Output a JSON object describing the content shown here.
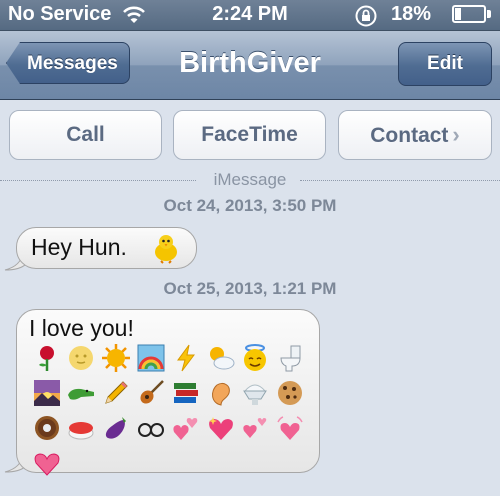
{
  "status_bar": {
    "carrier": "No Service",
    "time": "2:24 PM",
    "battery": "18%",
    "icons": [
      "wifi-icon",
      "rotation-lock-icon",
      "battery-icon"
    ]
  },
  "nav": {
    "back_label": "Messages",
    "title": "BirthGiver",
    "edit_label": "Edit"
  },
  "actions": {
    "call": "Call",
    "facetime": "FaceTime",
    "contact": "Contact"
  },
  "separator": "iMessage",
  "messages": [
    {
      "timestamp": "Oct 24, 2013, 3:50 PM",
      "text": "Hey Hun.",
      "emoji": [
        "chick"
      ]
    },
    {
      "timestamp": "Oct 25, 2013, 1:21 PM",
      "text": "I love you!",
      "emoji": [
        "rose",
        "full-moon",
        "sun-face",
        "rainbow",
        "lightning",
        "sun-behind-cloud",
        "smiling-face-halo",
        "toilet",
        "sunrise",
        "crocodile",
        "pencil",
        "guitar",
        "books",
        "shell",
        "shaved-ice",
        "cookie",
        "doughnut",
        "sushi",
        "eggplant",
        "glasses",
        "two-hearts",
        "sparkling-heart",
        "revolving-hearts",
        "beating-heart",
        "pink-heart"
      ]
    }
  ],
  "colors": {
    "nav": "#6d86a6",
    "background": "#dbe2ec",
    "button_text": "#5b6a82"
  }
}
